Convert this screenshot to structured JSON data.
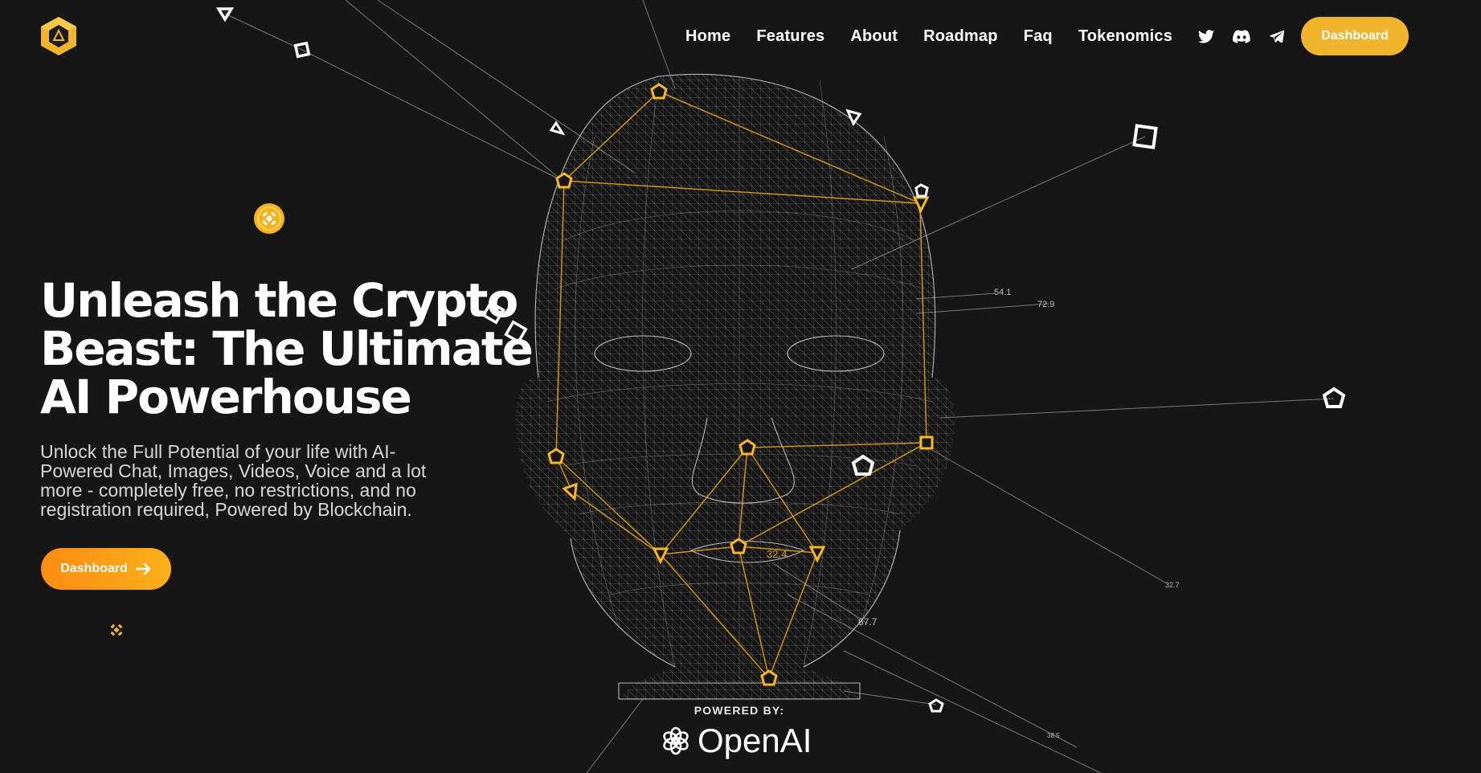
{
  "nav": {
    "items": [
      "Home",
      "Features",
      "About",
      "Roadmap",
      "Faq",
      "Tokenomics"
    ],
    "dashboard_label": "Dashboard"
  },
  "socials": [
    "twitter-icon",
    "discord-icon",
    "telegram-icon"
  ],
  "hero": {
    "title_line1": "Unleash the Crypto",
    "title_line2": "Beast: The Ultimate",
    "title_line3": "AI Powerhouse",
    "subtitle": "Unlock the Full Potential of your life with AI-Powered Chat, Images, Videos, Voice and a lot more - completely free, no restrictions, and no registration required, Powered by Blockchain.",
    "button_label": "Dashboard"
  },
  "powered": {
    "label": "POWERED BY:",
    "brand": "OpenAI"
  },
  "face_readouts": [
    "54.1",
    "72.9",
    "32.4",
    "32.7",
    "67.7",
    "38.5"
  ],
  "colors": {
    "background": "#161616",
    "accent": "#f0b52d",
    "gradient_start": "#fb8c13",
    "gradient_end": "#fbb01a"
  }
}
